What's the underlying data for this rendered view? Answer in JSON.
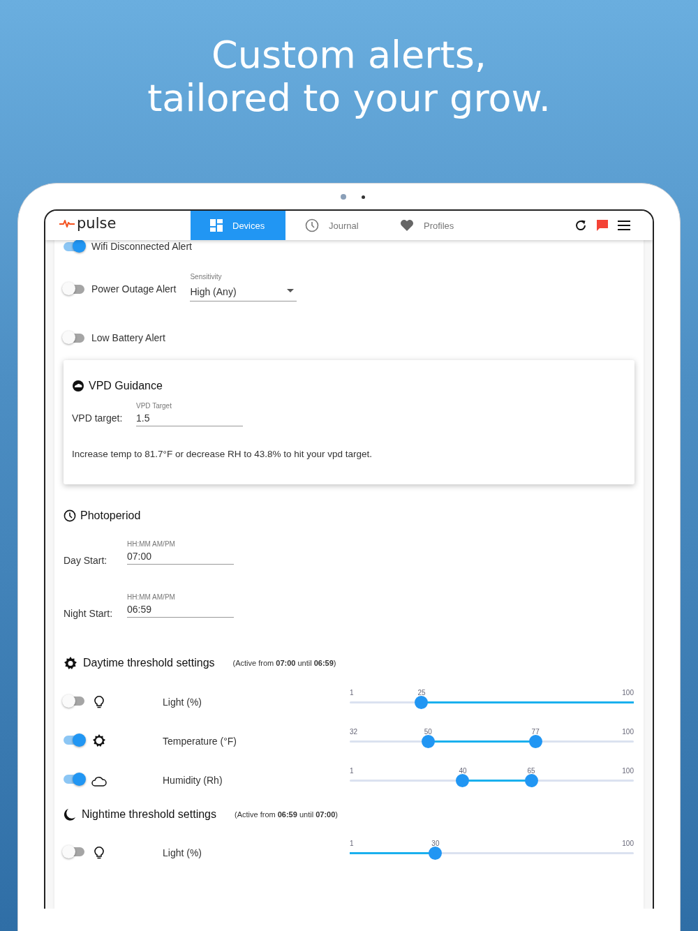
{
  "headline": "Custom alerts,\ntailored to your grow.",
  "app": {
    "logo": "pulse",
    "tabs": [
      {
        "label": "Devices",
        "kind": "grid",
        "selected": true
      },
      {
        "label": "Journal",
        "kind": "clock",
        "selected": false
      },
      {
        "label": "Profiles",
        "kind": "heart",
        "selected": false
      }
    ],
    "toolbar": [
      {
        "kind": "refresh"
      },
      {
        "kind": "chat"
      },
      {
        "kind": "menu"
      }
    ]
  },
  "alerts": [
    {
      "label": "Wifi Disconnected Alert",
      "on": true
    },
    {
      "label": "Power Outage Alert",
      "on": false,
      "select": {
        "label": "Sensitivity",
        "value": "High (Any)"
      }
    },
    {
      "label": "Low Battery Alert",
      "on": false
    }
  ],
  "vpd": {
    "title": "VPD Guidance",
    "field_label": "VPD target:",
    "field": {
      "label": "VPD Target",
      "value": "1.5"
    },
    "message": "Increase temp to 81.7°F or decrease RH to 43.8% to hit your vpd target."
  },
  "photoperiod": {
    "title": "Photoperiod",
    "fields": [
      {
        "label": "Day Start:",
        "hint": "HH:MM AM/PM",
        "value": "07:00"
      },
      {
        "label": "Night Start:",
        "hint": "HH:MM AM/PM",
        "value": "06:59"
      }
    ]
  },
  "thresholds": [
    {
      "kind": "day",
      "title": "Daytime threshold settings",
      "note": "(Active from **07:00** until **06:59**)",
      "rows": [
        {
          "kind": "light",
          "label": "Light (%)",
          "on": false,
          "min": "1",
          "max": "100",
          "inverted": true,
          "thumbs": [
            {
              "value": "25",
              "level": 0.253
            }
          ]
        },
        {
          "kind": "temperature",
          "label": "Temperature (°F)",
          "on": true,
          "min": "32",
          "max": "100",
          "inverted": false,
          "thumbs": [
            {
              "value": "50",
              "level": 0.276
            },
            {
              "value": "77",
              "level": 0.654
            }
          ]
        },
        {
          "kind": "humidity",
          "label": "Humidity (Rh)",
          "on": true,
          "min": "1",
          "max": "100",
          "inverted": false,
          "thumbs": [
            {
              "value": "40",
              "level": 0.398
            },
            {
              "value": "65",
              "level": 0.639
            }
          ]
        }
      ]
    },
    {
      "kind": "night",
      "title": "Nightime threshold settings",
      "note": "(Active from **06:59** until **07:00**)",
      "rows": [
        {
          "kind": "light",
          "label": "Light (%)",
          "on": false,
          "min": "1",
          "max": "100",
          "inverted": false,
          "thumbs": [
            {
              "value": "30",
              "level": 0.302
            }
          ]
        }
      ]
    }
  ]
}
